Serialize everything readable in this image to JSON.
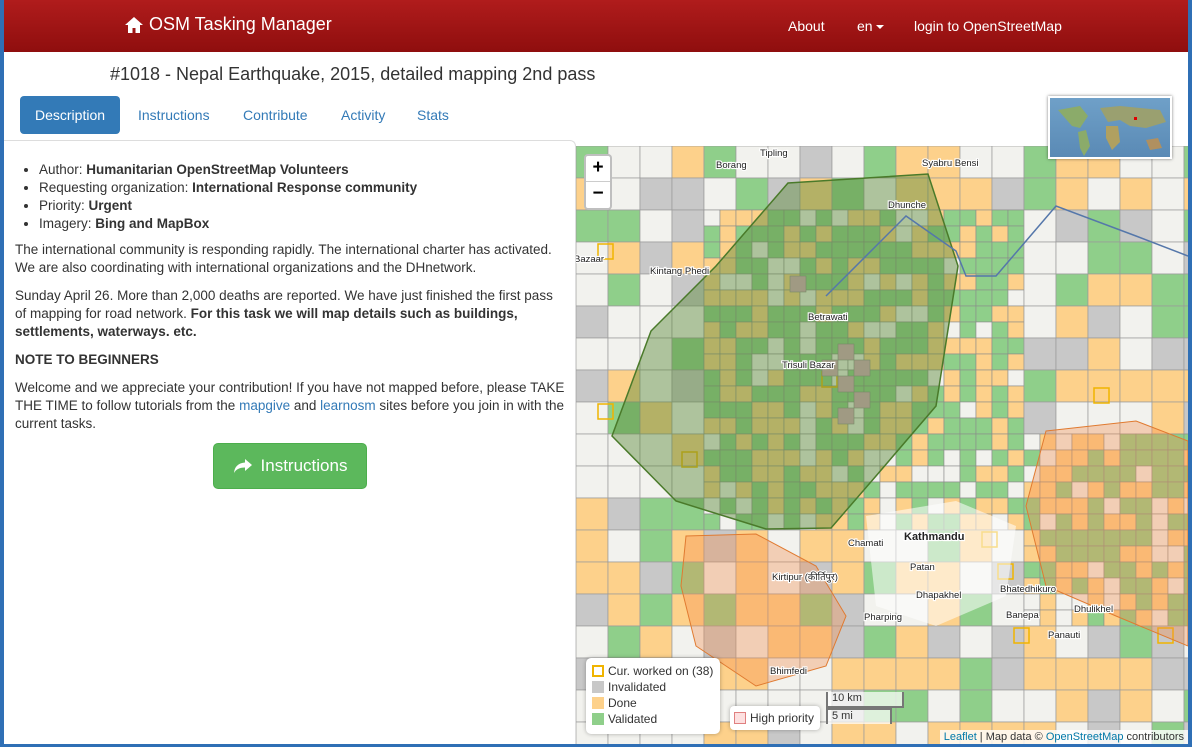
{
  "navbar": {
    "brand": "OSM Tasking Manager",
    "about": "About",
    "language": "en",
    "login": "login to OpenStreetMap",
    "colors": {
      "bar": "#9e1414"
    }
  },
  "project": {
    "title": "#1018 - Nepal Earthquake, 2015, detailed mapping 2nd pass"
  },
  "tabs": [
    {
      "label": "Description"
    },
    {
      "label": "Instructions"
    },
    {
      "label": "Contribute"
    },
    {
      "label": "Activity"
    },
    {
      "label": "Stats"
    }
  ],
  "description": {
    "meta": [
      {
        "label": "Author:",
        "value": "Humanitarian OpenStreetMap Volunteers"
      },
      {
        "label": "Requesting organization:",
        "value": "International Response community"
      },
      {
        "label": "Priority:",
        "value": "Urgent"
      },
      {
        "label": "Imagery:",
        "value": "Bing and MapBox"
      }
    ],
    "para1": "The international community is responding rapidly. The international charter has activated. We are also coordinating with international organizations and the DHnetwork.",
    "para2_plain": "Sunday April 26. More than 2,000 deaths are reported. We have just finished the first pass of mapping for road network. ",
    "para2_bold": "For this task we will map details such as buildings, settlements, waterways. etc.",
    "note_heading": "NOTE TO BEGINNERS",
    "para3_a": "Welcome and we appreciate your contribution! If you have not mapped before, please TAKE THE TIME to follow tutorials from the ",
    "link_mapgive": "mapgive",
    "para3_b": " and ",
    "link_learnosm": "learnosm",
    "para3_c": " sites before you join in with the current tasks.",
    "button": "Instructions"
  },
  "map": {
    "zoom_in": "+",
    "zoom_out": "−",
    "legend": [
      {
        "label": "Cur. worked on (38)",
        "color": "#f0b400",
        "kind": "outline"
      },
      {
        "label": "Invalidated",
        "color": "#c8c8c8",
        "kind": "fill"
      },
      {
        "label": "Done",
        "color": "#fdd18b",
        "kind": "fill"
      },
      {
        "label": "Validated",
        "color": "#8fcf8a",
        "kind": "fill"
      }
    ],
    "high_priority": "High priority",
    "scale_km": "10 km",
    "scale_mi": "5 mi",
    "attribution_leaflet": "Leaflet",
    "attribution_mid": " | Map data © ",
    "attribution_osm": "OpenStreetMap",
    "attribution_end": " contributors",
    "places": [
      "Borang",
      "Tipling",
      "Syabru Bensi",
      "Dhunche",
      "Bazaar",
      "Kintang Phedi",
      "Betrawati",
      "Trisuli Bazar",
      "Chamati",
      "Kathmandu",
      "Kirtipur (कीर्तिपुर)",
      "Patan",
      "Dhapakhel",
      "Bhatedhikuro",
      "Banepa",
      "Dhulikhel",
      "Panauti",
      "Pharping",
      "Bhimfedi"
    ]
  }
}
